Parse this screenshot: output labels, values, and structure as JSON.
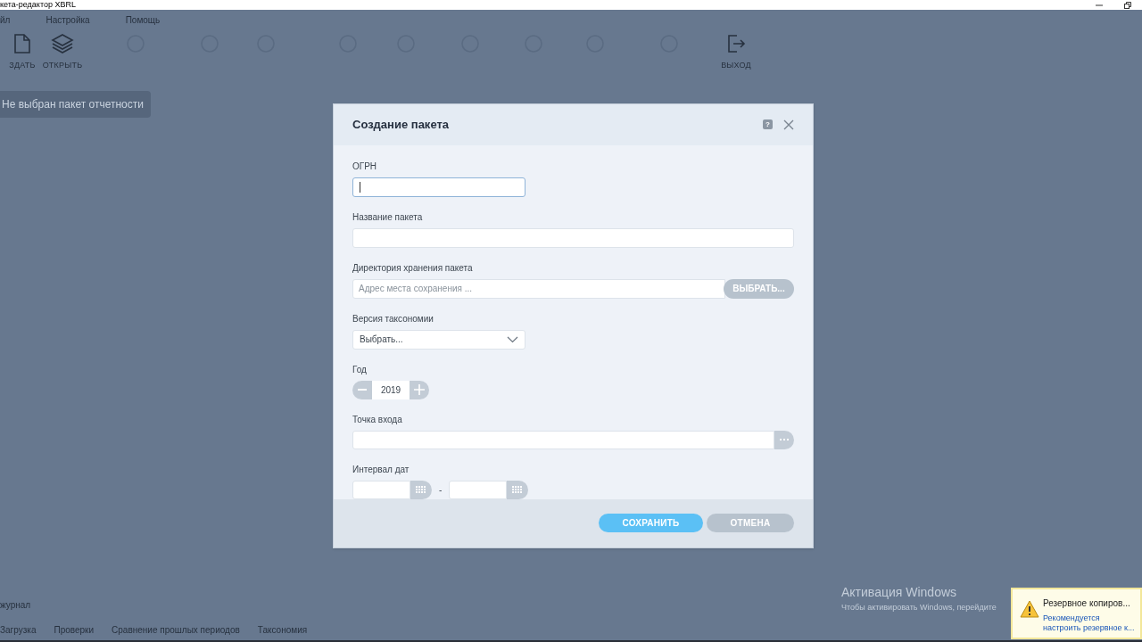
{
  "window": {
    "title": "кета-редактор XBRL"
  },
  "menu": [
    {
      "label": "йл"
    },
    {
      "label": "Настройка"
    },
    {
      "label": "Помощь"
    }
  ],
  "toolbar": [
    {
      "label": "ЗДАТЬ",
      "kind": "new",
      "disabled": false
    },
    {
      "label": "ОТКРЫТЬ",
      "kind": "open",
      "disabled": false
    },
    {
      "kind": "generic",
      "disabled": true
    },
    {
      "kind": "generic",
      "disabled": true
    },
    {
      "kind": "generic",
      "disabled": true
    },
    {
      "kind": "generic",
      "disabled": true
    },
    {
      "kind": "generic",
      "disabled": true
    },
    {
      "kind": "generic",
      "disabled": true
    },
    {
      "kind": "generic",
      "disabled": true
    },
    {
      "kind": "generic",
      "disabled": true
    },
    {
      "kind": "generic",
      "disabled": true
    },
    {
      "label": "ВЫХОД",
      "kind": "exit",
      "disabled": false
    }
  ],
  "package_status": "Не выбран пакет отчетности",
  "dialog": {
    "title": "Создание пакета",
    "help": "?",
    "ogrn": {
      "label": "ОГРН",
      "focused": true
    },
    "package_name": {
      "label": "Название пакета"
    },
    "directory": {
      "label": "Директория хранения пакета",
      "placeholder": "Адрес места сохранения ...",
      "button": "ВЫБРАТЬ..."
    },
    "taxonomy": {
      "label": "Версия таксономии",
      "value": "Выбрать..."
    },
    "year": {
      "label": "Год",
      "value": "2019"
    },
    "entry_point": {
      "label": "Точка входа"
    },
    "date_range": {
      "label": "Интервал дат",
      "separator": "-"
    },
    "buttons": [
      {
        "label": "СОХРАНИТЬ",
        "kind": "primary"
      },
      {
        "label": "ОТМЕНА",
        "kind": "secondary"
      }
    ]
  },
  "bottom_panel": {
    "title": "журнал",
    "tabs": [
      {
        "label": "Загрузка"
      },
      {
        "label": "Проверки"
      },
      {
        "label": "Сравнение прошлых периодов"
      },
      {
        "label": "Таксономия"
      }
    ]
  },
  "activation": {
    "title": "Активация Windows",
    "text": "Чтобы активировать Windows, перейдите"
  },
  "notification": {
    "title": "Резервное копиров...",
    "lines": [
      "Рекомендуется",
      "настроить резервное к..."
    ]
  }
}
